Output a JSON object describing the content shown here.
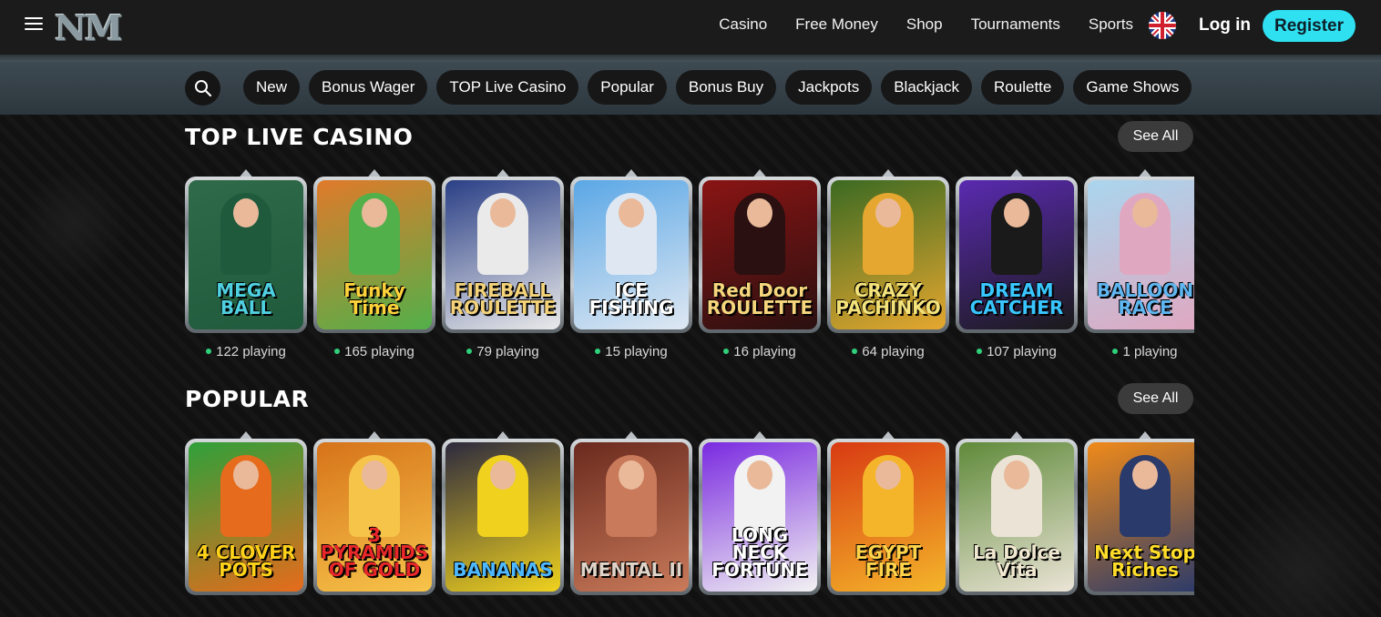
{
  "header": {
    "logo": "NM",
    "nav": [
      "Casino",
      "Free Money",
      "Shop",
      "Tournaments",
      "Sports"
    ],
    "login_label": "Log in",
    "register_label": "Register",
    "language_icon": "uk-flag-icon"
  },
  "categories": [
    "New",
    "Bonus Wager",
    "TOP Live Casino",
    "Popular",
    "Bonus Buy",
    "Jackpots",
    "Blackjack",
    "Roulette",
    "Game Shows"
  ],
  "sections": {
    "live": {
      "title": "TOP LIVE CASINO",
      "see_all": "See All",
      "games": [
        {
          "name": "MEGA BALL",
          "players": "122 playing",
          "bg": "#2f6b4a",
          "accent": "#1f5a3c",
          "text_color": "#4fd0e0"
        },
        {
          "name": "Funky Time",
          "players": "165 playing",
          "bg": "#e07a2a",
          "accent": "#52b04a",
          "text_color": "#ffd23a"
        },
        {
          "name": "FIREBALL ROULETTE",
          "players": "79 playing",
          "bg": "#2a3f86",
          "accent": "#eaeaea",
          "text_color": "#f3d27a"
        },
        {
          "name": "ICE FISHING",
          "players": "15 playing",
          "bg": "#5aa7e6",
          "accent": "#dfe8f2",
          "text_color": "#ffffff"
        },
        {
          "name": "Red Door ROULETTE",
          "players": "16 playing",
          "bg": "#8a1414",
          "accent": "#2a1010",
          "text_color": "#f6d57c"
        },
        {
          "name": "CRAZY PACHINKO",
          "players": "64 playing",
          "bg": "#3b6a22",
          "accent": "#e5a72f",
          "text_color": "#f4e27a"
        },
        {
          "name": "DREAM CATCHER",
          "players": "107 playing",
          "bg": "#5a2ab0",
          "accent": "#1a1a1a",
          "text_color": "#39c6ff"
        },
        {
          "name": "BALLOON RACE",
          "players": "1 playing",
          "bg": "#a9d6ee",
          "accent": "#e0a7c0",
          "text_color": "#5fb6f0"
        }
      ]
    },
    "popular": {
      "title": "POPULAR",
      "see_all": "See All",
      "games": [
        {
          "name": "4 CLOVER POTS",
          "bg": "#2fa03a",
          "accent": "#e66b1c",
          "text_color": "#ffd21a"
        },
        {
          "name": "3 PYRAMIDS OF GOLD",
          "bg": "#d6731a",
          "accent": "#f7c44a",
          "text_color": "#e8272a"
        },
        {
          "name": "BANANAS",
          "bg": "#2d2a3e",
          "accent": "#f0d21e",
          "text_color": "#4db8ff"
        },
        {
          "name": "MENTAL II",
          "bg": "#6a2a1e",
          "accent": "#c97a5a",
          "text_color": "#e0d4c8"
        },
        {
          "name": "LONG NECK FORTUNE",
          "bg": "#7a2ae0",
          "accent": "#f2f2f2",
          "text_color": "#ffffff"
        },
        {
          "name": "EGYPT FIRE",
          "bg": "#d83a12",
          "accent": "#f4b52a",
          "text_color": "#ffd44a"
        },
        {
          "name": "La Dolce Vita",
          "bg": "#5f8a3a",
          "accent": "#ebe4d6",
          "text_color": "#f0e8d0"
        },
        {
          "name": "Next Stop Riches",
          "bg": "#f08a1a",
          "accent": "#2a3a6a",
          "text_color": "#ffdd2a"
        }
      ]
    }
  }
}
